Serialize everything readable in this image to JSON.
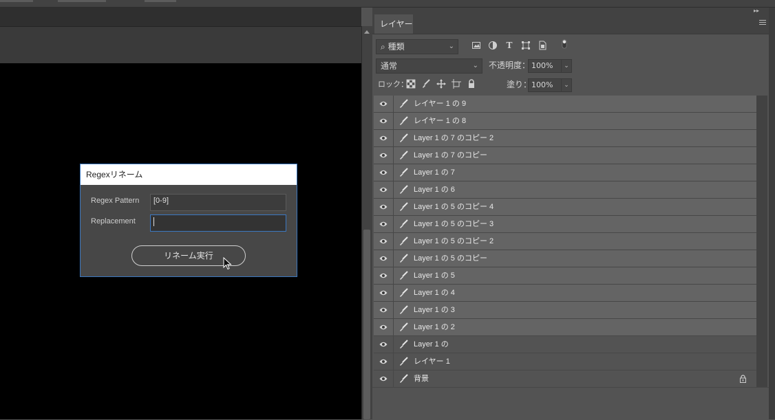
{
  "dialog": {
    "title": "Regexリネーム",
    "pattern_label": "Regex Pattern",
    "pattern_value": "[0-9]",
    "replacement_label": "Replacement",
    "replacement_value": "",
    "button_label": "リネーム実行"
  },
  "panel": {
    "tab_label": "レイヤー",
    "filter_kind": "種類",
    "blend_mode": "通常",
    "opacity_label": "不透明度：",
    "opacity_value": "100%",
    "lock_label": "ロック：",
    "fill_label": "塗り：",
    "fill_value": "100%"
  },
  "layers": [
    {
      "name": "レイヤー 1 の 9",
      "selected": true
    },
    {
      "name": "レイヤー 1 の 8",
      "selected": true
    },
    {
      "name": "Layer 1 の 7 のコピー 2",
      "selected": true
    },
    {
      "name": "Layer 1 の 7 のコピー",
      "selected": true
    },
    {
      "name": "Layer 1 の 7",
      "selected": true
    },
    {
      "name": "Layer 1 の 6",
      "selected": true
    },
    {
      "name": "Layer 1 の 5 のコピー 4",
      "selected": true
    },
    {
      "name": "Layer 1 の 5 のコピー 3",
      "selected": true
    },
    {
      "name": "Layer 1 の 5 のコピー 2",
      "selected": true
    },
    {
      "name": "Layer 1 の 5 のコピー",
      "selected": true
    },
    {
      "name": "Layer 1 の 5",
      "selected": true
    },
    {
      "name": "Layer 1 の 4",
      "selected": true
    },
    {
      "name": "Layer 1 の 3",
      "selected": true
    },
    {
      "name": "Layer 1 の 2",
      "selected": true
    },
    {
      "name": "Layer 1 の",
      "selected": false
    },
    {
      "name": "レイヤー 1",
      "selected": false
    },
    {
      "name": "背景",
      "selected": false,
      "locked": true
    }
  ],
  "colors": {
    "dialog_border": "#3b78c2",
    "layer_selected": "#646464",
    "layer_normal": "#535353"
  }
}
